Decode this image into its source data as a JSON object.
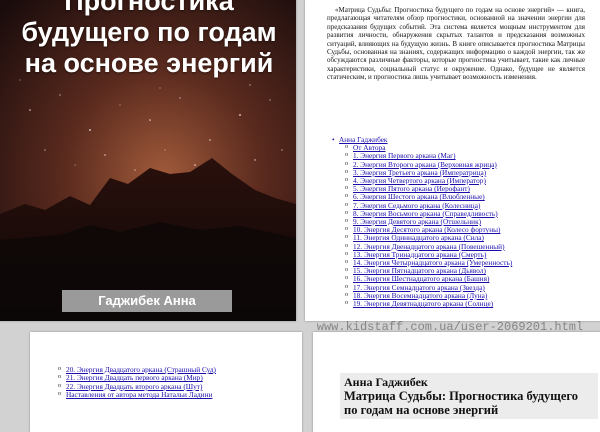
{
  "cover": {
    "title_lines": [
      "Прогностика",
      "будущего по годам",
      "на основе энергий"
    ],
    "author": "Гаджибек Анна"
  },
  "abstract": "«Матрица Судьбы: Прогностика будущего по годам на основе энергий» — книга, предлагающая читателям обзор прогностики, основанной на значении энергии для предсказания будущих событий. Эта система является мощным инструментом для развития личности, обнаружения скрытых талантов и предсказания возможных ситуаций, влияющих на будущую жизнь. В книге описывается прогностика Матрицы Судьбы, основанная на знаниях, содержащих информацию о каждой энергии, так же обсуждаются различные факторы, которые прогностика учитывает, такие как личные характеристики, социальный статус и окружение. Однако, будущее не является статическим, и прогностика лишь учитывает возможность изменения.",
  "toc": {
    "root": "Анна Гаджибек",
    "items": [
      "От Автора",
      "1. Энергия Первого аркана (Маг)",
      "2. Энергия Второго аркана (Верховная жрица)",
      "3. Энергия Третьего аркана (Императрица)",
      "4. Энергия Четвертого аркана (Император)",
      "5. Энергия Пятого аркана (Иерофант)",
      "6. Энергия Шестого аркана (Влюбленные)",
      "7. Энергия Седьмого аркана (Колесница)",
      "8. Энергия Восьмого аркана (Справедливость)",
      "9. Энергия Девятого аркана (Отшельник)",
      "10. Энергия Десятого аркана (Колесо фортуны)",
      "11. Энергия Одиннадцатого аркана (Сила)",
      "12. Энергия Двенадцатого аркана (Повешенный)",
      "13. Энергия Тринадцатого аркана (Смерть)",
      "14. Энергия Четырнадцатого аркана (Умеренность)",
      "15. Энергия Пятнадцатого аркана (Дьявол)",
      "16. Энергия Шестнадцатого аркана (Башня)",
      "17. Энергия Семнадцатого аркана (Звезда)",
      "18. Энергия Восемнадцатого аркана (Луна)",
      "19. Энергия Девятнадцатого аркана (Солнце)"
    ],
    "continued": [
      "20. Энергия Двадцатого аркана (Страшный Суд)",
      "21. Энергия Двадцать первого аркана (Мир)",
      "22. Энергия Двадцать второго аркана (Шут)",
      "Наставления от автора метода Натальи Ладини"
    ]
  },
  "heading": {
    "author": "Анна Гаджибек",
    "title": "Матрица Судьбы: Прогностика будущего по годам на основе энергий"
  },
  "watermark": "www.kidstaff.com.ua/user-2069201.html"
}
